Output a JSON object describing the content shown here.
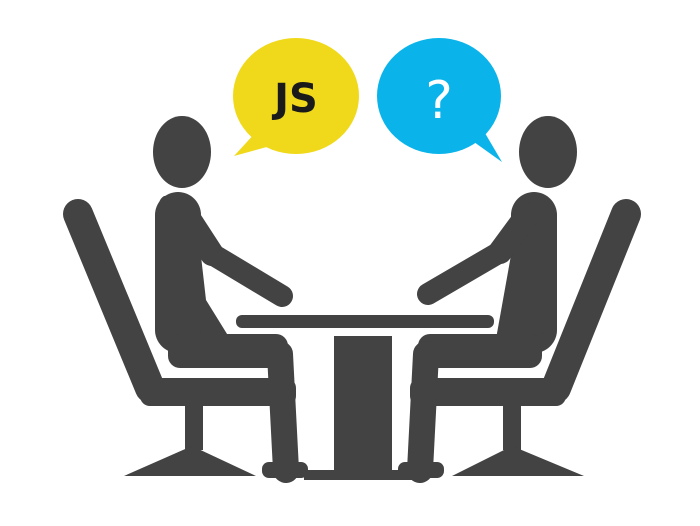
{
  "illustration": {
    "left_bubble": {
      "text": "JS",
      "color": "#f0d91b",
      "text_color": "#1a1a1a"
    },
    "right_bubble": {
      "text": "?",
      "color": "#0ab4ea",
      "text_color": "#ffffff"
    },
    "figure_color": "#434343",
    "background": "#ffffff"
  }
}
